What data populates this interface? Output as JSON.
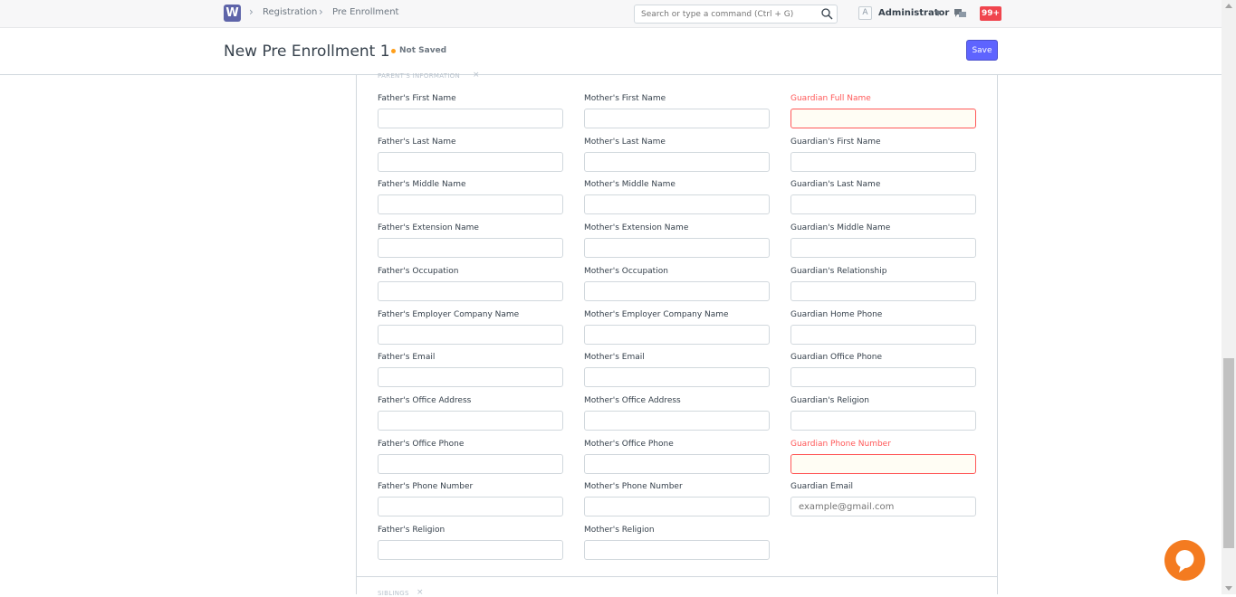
{
  "topbar": {
    "logo": "W",
    "breadcrumbs": [
      "Registration",
      "Pre Enrollment"
    ],
    "search_placeholder": "Search or type a command (Ctrl + G)",
    "avatar_letter": "A",
    "user_name": "Administrator",
    "notification_count": "99+"
  },
  "page": {
    "title": "New Pre Enrollment 1",
    "status": "Not Saved",
    "save_label": "Save"
  },
  "section": {
    "title": "PARENT'S INFORMATION",
    "next_title": "SIBLINGS"
  },
  "columns": [
    {
      "fields": [
        {
          "label": "Father's First Name",
          "value": "",
          "placeholder": ""
        },
        {
          "label": "Father's Last Name",
          "value": "",
          "placeholder": ""
        },
        {
          "label": "Father's Middle Name",
          "value": "",
          "placeholder": ""
        },
        {
          "label": "Father's Extension Name",
          "value": "",
          "placeholder": ""
        },
        {
          "label": "Father's Occupation",
          "value": "",
          "placeholder": ""
        },
        {
          "label": "Father's Employer Company Name",
          "value": "",
          "placeholder": ""
        },
        {
          "label": "Father's Email",
          "value": "",
          "placeholder": ""
        },
        {
          "label": "Father's Office Address",
          "value": "",
          "placeholder": ""
        },
        {
          "label": "Father's Office Phone",
          "value": "",
          "placeholder": ""
        },
        {
          "label": "Father's Phone Number",
          "value": "",
          "placeholder": ""
        },
        {
          "label": "Father's Religion",
          "value": "",
          "placeholder": ""
        }
      ]
    },
    {
      "fields": [
        {
          "label": "Mother's First Name",
          "value": "",
          "placeholder": ""
        },
        {
          "label": "Mother's Last Name",
          "value": "",
          "placeholder": ""
        },
        {
          "label": "Mother's Middle Name",
          "value": "",
          "placeholder": ""
        },
        {
          "label": "Mother's Extension Name",
          "value": "",
          "placeholder": ""
        },
        {
          "label": "Mother's Occupation",
          "value": "",
          "placeholder": ""
        },
        {
          "label": "Mother's Employer Company Name",
          "value": "",
          "placeholder": ""
        },
        {
          "label": "Mother's Email",
          "value": "",
          "placeholder": ""
        },
        {
          "label": "Mother's Office Address",
          "value": "",
          "placeholder": ""
        },
        {
          "label": "Mother's Office Phone",
          "value": "",
          "placeholder": ""
        },
        {
          "label": "Mother's Phone Number",
          "value": "",
          "placeholder": ""
        },
        {
          "label": "Mother's Religion",
          "value": "",
          "placeholder": ""
        }
      ]
    },
    {
      "fields": [
        {
          "label": "Guardian Full Name",
          "value": "",
          "placeholder": "",
          "required": true
        },
        {
          "label": "Guardian's First Name",
          "value": "",
          "placeholder": ""
        },
        {
          "label": "Guardian's Last Name",
          "value": "",
          "placeholder": ""
        },
        {
          "label": "Guardian's Middle Name",
          "value": "",
          "placeholder": ""
        },
        {
          "label": "Guardian's Relationship",
          "value": "",
          "placeholder": ""
        },
        {
          "label": "Guardian Home Phone",
          "value": "",
          "placeholder": ""
        },
        {
          "label": "Guardian Office Phone",
          "value": "",
          "placeholder": ""
        },
        {
          "label": "Guardian's Religion",
          "value": "",
          "placeholder": ""
        },
        {
          "label": "Guardian Phone Number",
          "value": "",
          "placeholder": "",
          "required": true
        },
        {
          "label": "Guardian Email",
          "value": "",
          "placeholder": "example@gmail.com"
        }
      ]
    }
  ],
  "colors": {
    "accent": "#5e64ff",
    "required": "#ff5858",
    "unsaved_dot": "#ff9f1a",
    "notification": "#f0454e",
    "chat_widget": "#f47b20"
  },
  "icons": [
    "search-icon",
    "chevron-right-icon",
    "chat-icon",
    "close-icon",
    "chat-bubble-icon"
  ]
}
